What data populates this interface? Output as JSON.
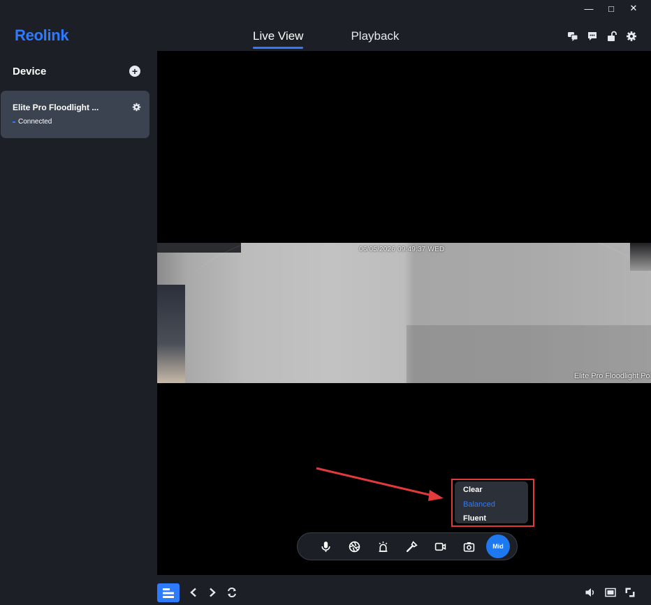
{
  "window": {
    "minimize_glyph": "—",
    "maximize_glyph": "□",
    "close_glyph": "✕"
  },
  "header": {
    "logo": "Reolink",
    "tabs": [
      {
        "label": "Live View",
        "active": true
      },
      {
        "label": "Playback",
        "active": false
      }
    ],
    "icons": [
      "message-translate-icon",
      "chat-icon",
      "unlock-icon",
      "settings-gear-icon"
    ]
  },
  "sidebar": {
    "title": "Device",
    "add_icon": "+",
    "devices": [
      {
        "name": "Elite Pro Floodlight ...",
        "status": "Connected"
      }
    ]
  },
  "video": {
    "timestamp": "06/05/2026 09:49:37 WED",
    "camera_label": "Elite Pro Floodlight PoE"
  },
  "quality_menu": {
    "options": [
      {
        "label": "Clear",
        "active": false
      },
      {
        "label": "Balanced",
        "active": true
      },
      {
        "label": "Fluent",
        "active": false
      }
    ]
  },
  "toolbar": {
    "buttons": [
      "microphone-icon",
      "aperture-icon",
      "siren-icon",
      "flashlight-icon",
      "record-icon",
      "snapshot-icon"
    ],
    "stream_label": "Mid"
  },
  "colors": {
    "accent": "#2f7bff",
    "background": "#1c1f26",
    "card": "#3a434f",
    "annotation": "#e03a3a"
  }
}
